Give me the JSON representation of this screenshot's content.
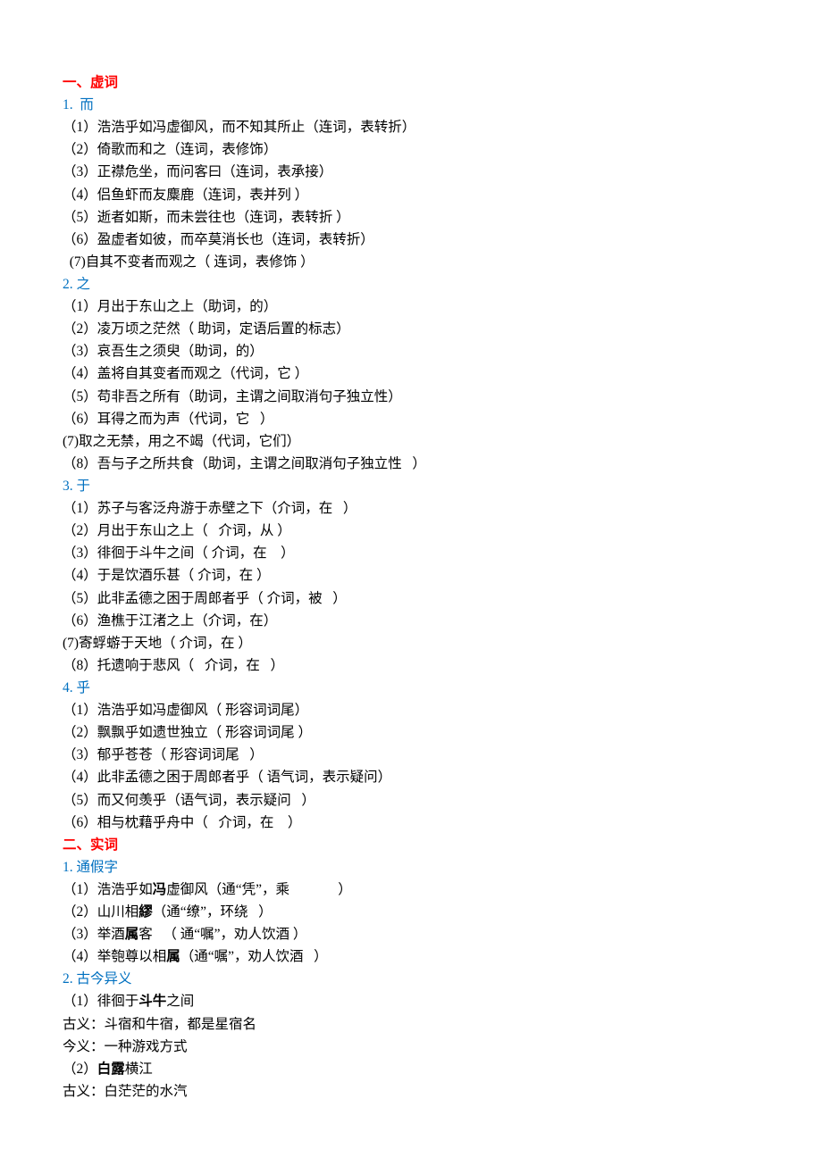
{
  "s1": {
    "title": "一、虚词",
    "g1": {
      "hd": "1.  而",
      "items": [
        "（1）浩浩乎如冯虚御风，而不知其所止（连词，表转折）",
        "（2）倚歌而和之（连词，表修饰）",
        "（3）正襟危坐，而问客曰（连词，表承接）",
        "（4）侣鱼虾而友麋鹿（连词，表并列 ）",
        "（5）逝者如斯，而未尝往也（连词，表转折 ）",
        "（6）盈虚者如彼，而卒莫消长也（连词，表转折）",
        "  (7)自其不变者而观之（ 连词，表修饰 ）"
      ]
    },
    "g2": {
      "hd": "2. 之",
      "items": [
        "（1）月出于东山之上（助词，的）",
        "（2）凌万顷之茫然（ 助词，定语后置的标志）",
        "（3）哀吾生之须臾（助词，的）",
        "（4）盖将自其变者而观之（代词，它 ）",
        "（5）苟非吾之所有（助词，主谓之间取消句子独立性）",
        "（6）耳得之而为声（代词，它   ）",
        "(7)取之无禁，用之不竭（代词，它们）",
        "（8）吾与子之所共食（助词，主谓之间取消句子独立性   ）"
      ]
    },
    "g3": {
      "hd": "3. 于",
      "items": [
        "（1）苏子与客泛舟游于赤壁之下（介词，在   ）",
        "（2）月出于东山之上（   介词，从 ）",
        "（3）徘徊于斗牛之间（ 介词，在    ）",
        "（4）于是饮酒乐甚（ 介词，在 ）",
        "（5）此非孟德之困于周郎者乎（ 介词，被   ）",
        "（6）渔樵于江渚之上（介词，在）",
        "(7)寄蜉蝣于天地（ 介词，在 ）",
        "（8）托遗响于悲风（   介词，在   ）"
      ]
    },
    "g4": {
      "hd": "4. 乎",
      "items": [
        "（1）浩浩乎如冯虚御风（ 形容词词尾）",
        "（2）飘飘乎如遗世独立（ 形容词词尾 ）",
        "（3）郁乎苍苍（ 形容词词尾   ）",
        "（4）此非孟德之困于周郎者乎（ 语气词，表示疑问）",
        "（5）而又何羡乎（语气词，表示疑问   ）",
        "（6）相与枕藉乎舟中（   介词，在    ）"
      ]
    }
  },
  "s2": {
    "title": "二、实词",
    "g1": {
      "hd": "1. 通假字",
      "items": [
        {
          "pre": "（1）浩浩乎如",
          "b": "冯",
          "post": "虚御风（通“凭”，乘              ）"
        },
        {
          "pre": "（2）山川相",
          "b": "繆",
          "post": "（通“缭”，环绕   ）"
        },
        {
          "pre": "（3）举酒",
          "b": "属",
          "post": "客   （ 通“嘱”，劝人饮酒 ）"
        },
        {
          "pre": "（4）举匏尊以相",
          "b": "属",
          "post": "（通“嘱”，劝人饮酒   ）"
        }
      ]
    },
    "g2": {
      "hd": "2. 古今异义",
      "i1": {
        "pre": "（1）徘徊于",
        "b": "斗牛",
        "post": "之间"
      },
      "i1g": "古义：斗宿和牛宿，都是星宿名",
      "i1j": "今义：一种游戏方式",
      "i2": {
        "pre": "（2）",
        "b": "白露",
        "post": "横江"
      },
      "i2g": "古义：白茫茫的水汽"
    }
  }
}
